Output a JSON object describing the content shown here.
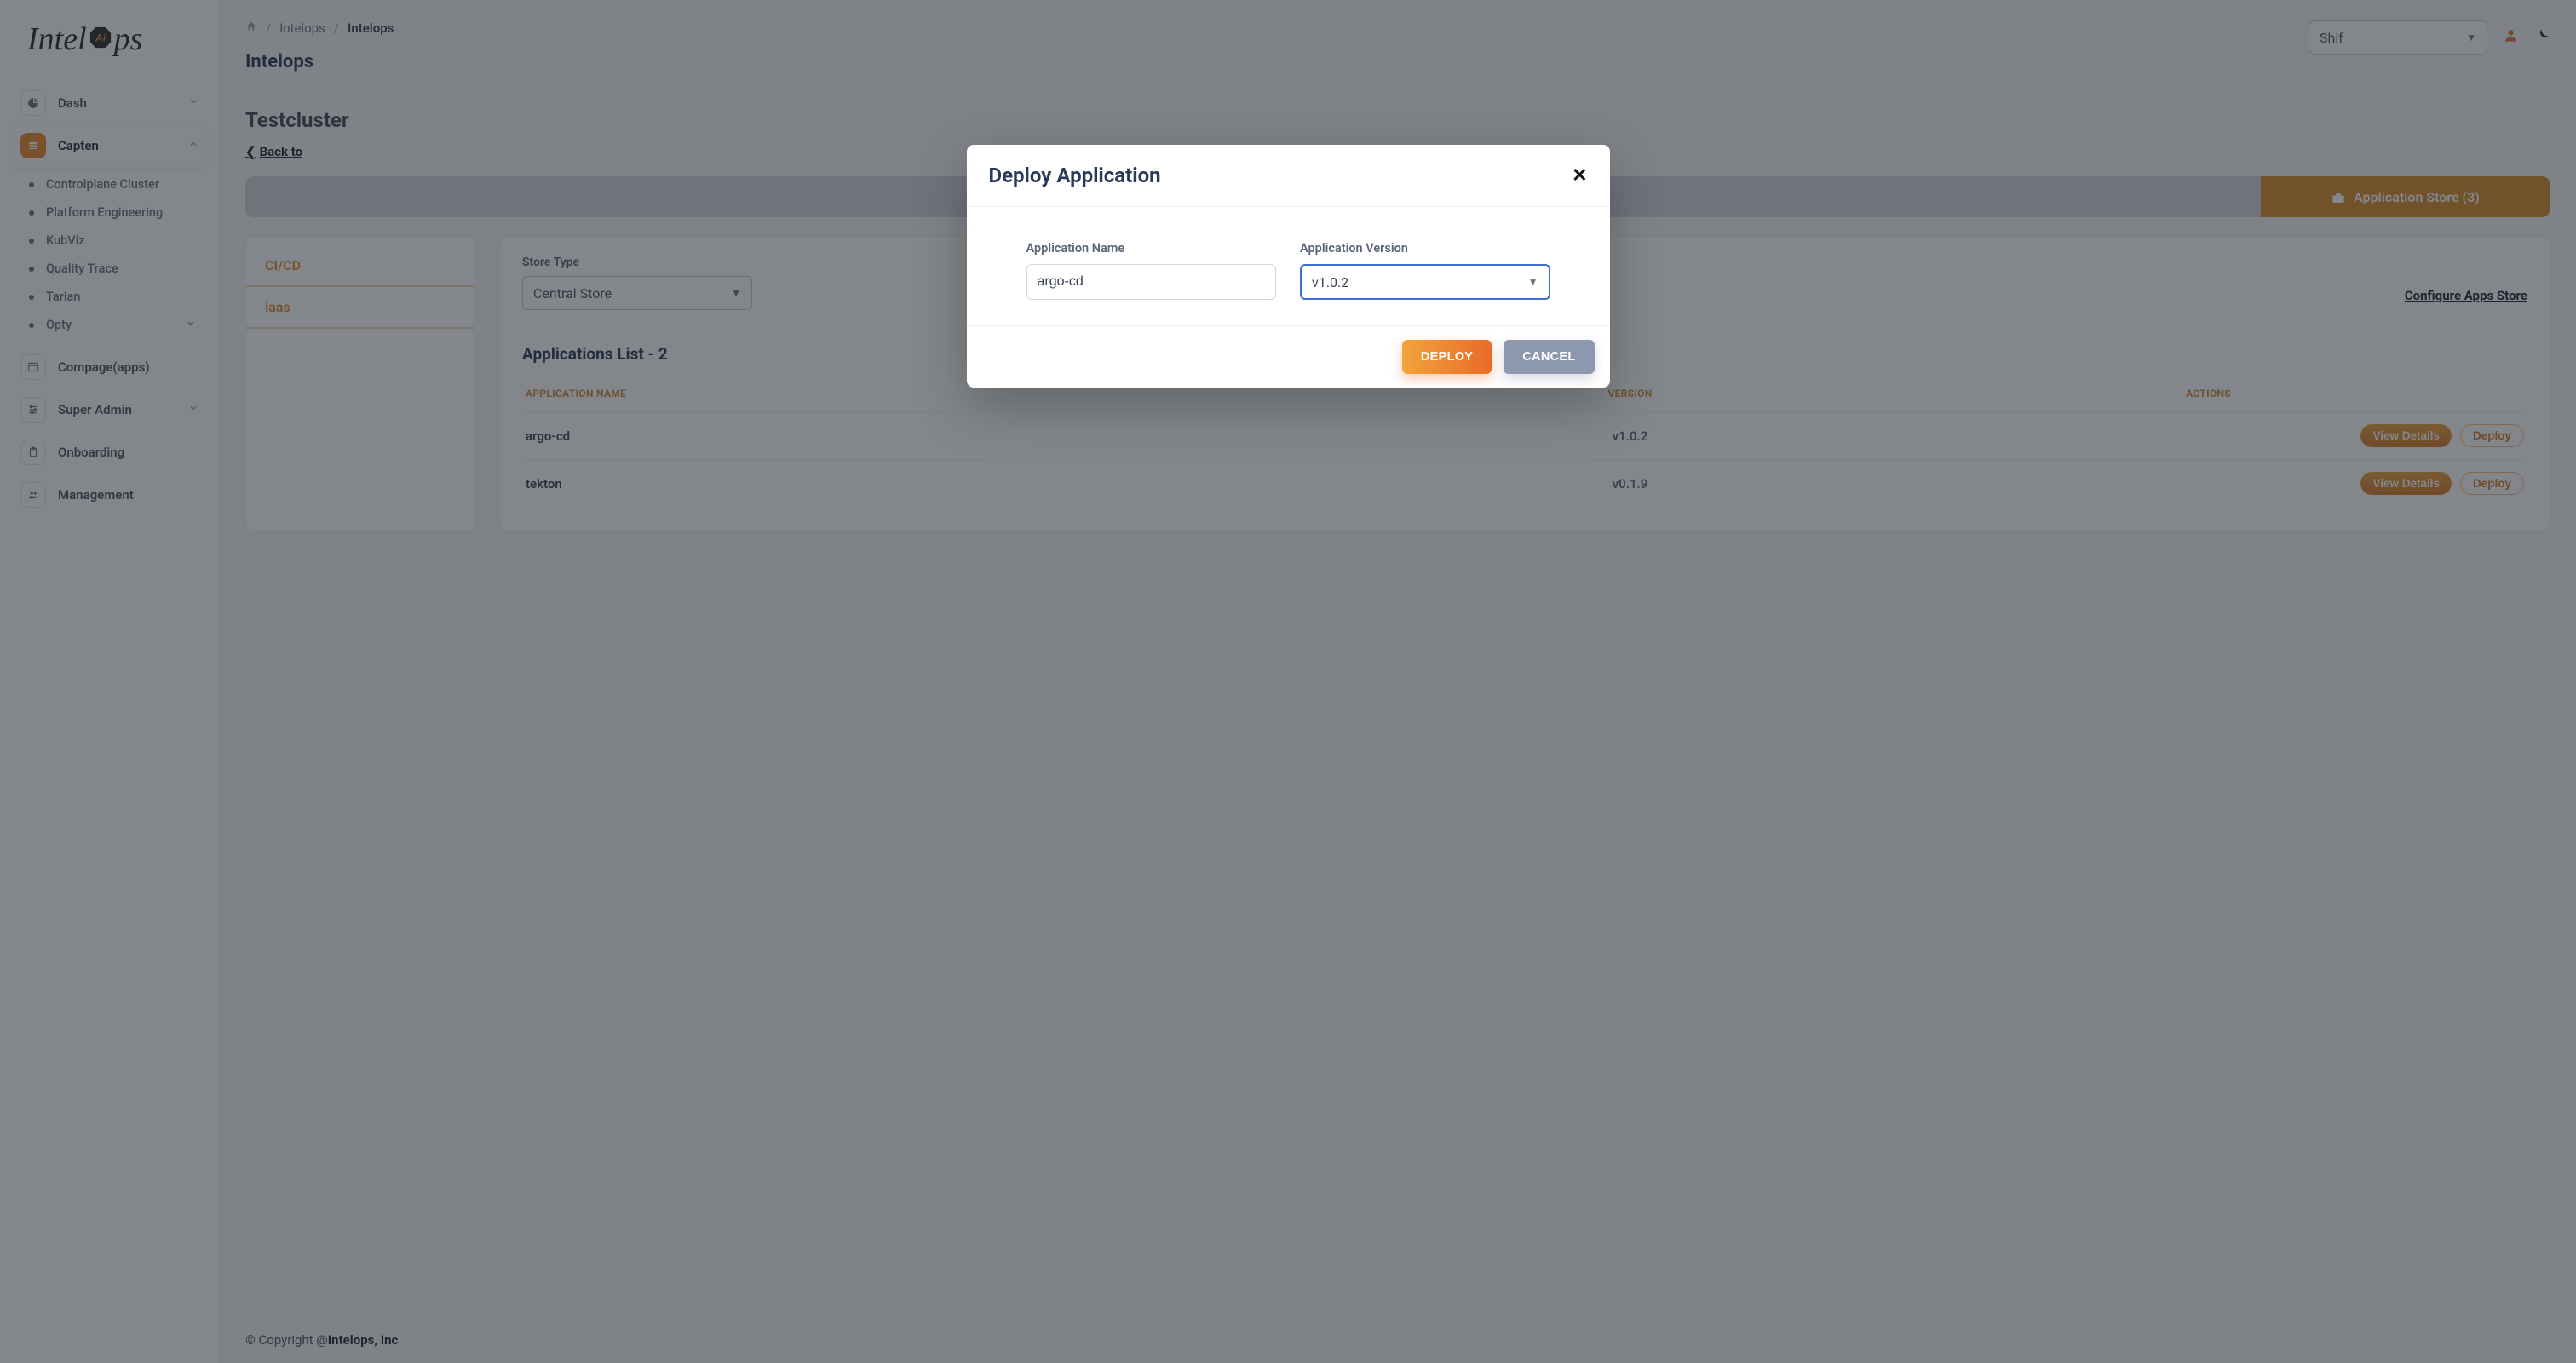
{
  "logo": {
    "prefix": "Intel",
    "badge": "Ai",
    "suffix": "ps"
  },
  "breadcrumbs": {
    "item1": "Intelops",
    "item2": "Intelops"
  },
  "page_title": "Intelops",
  "top_select": {
    "value": "Shif"
  },
  "sidebar": {
    "dash": "Dash",
    "capten": "Capten",
    "sub": {
      "controlplane": "Controlplane Cluster",
      "platform": "Platform Engineering",
      "kubviz": "KubViz",
      "quality": "Quality Trace",
      "tarian": "Tarian",
      "opty": "Opty"
    },
    "compage": "Compage(apps)",
    "superadmin": "Super Admin",
    "onboarding": "Onboarding",
    "management": "Management"
  },
  "cluster": {
    "title": "Testcluster",
    "back": "Back to ",
    "tab_active": "Application Store (3)",
    "mini_tabs": {
      "cicd": "CI/CD",
      "iaas": "iaas"
    },
    "store_type_label": "Store Type",
    "store_type_value": "Central Store",
    "configure": "Configure Apps Store",
    "list_title": "Applications List - 2",
    "thead": {
      "name": "APPLICATION NAME",
      "version": "VERSION",
      "actions": "ACTIONS"
    },
    "rows": [
      {
        "name": "argo-cd",
        "version": "v1.0.2"
      },
      {
        "name": "tekton",
        "version": "v0.1.9"
      }
    ],
    "btn_details": "View Details",
    "btn_deploy": "Deploy"
  },
  "footer": {
    "prefix": "© Copyright @",
    "brand": "Intelops, Inc"
  },
  "modal": {
    "title": "Deploy Application",
    "app_name_label": "Application Name",
    "app_name_value": "argo-cd",
    "app_version_label": "Application Version",
    "app_version_value": "v1.0.2",
    "deploy": "DEPLOY",
    "cancel": "CANCEL"
  }
}
